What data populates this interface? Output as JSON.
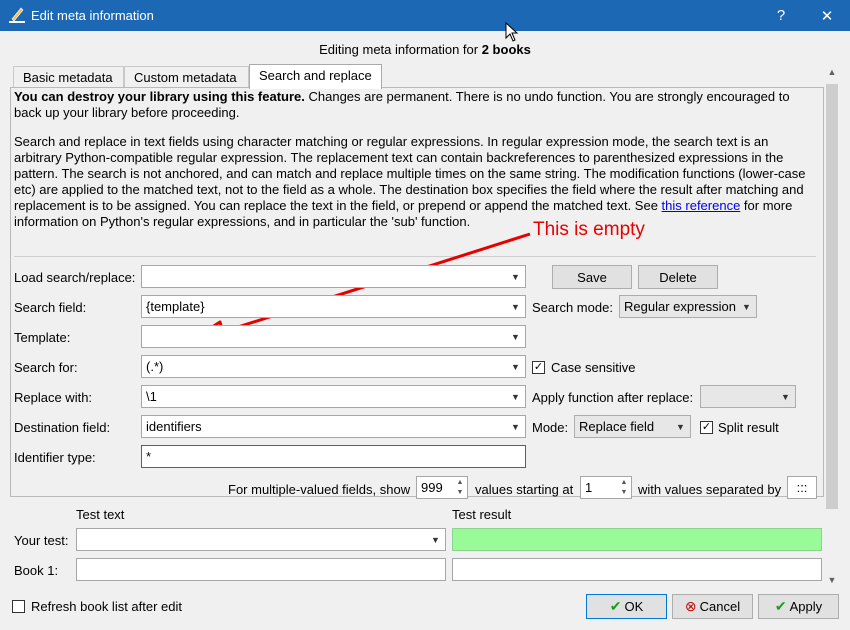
{
  "window": {
    "title": "Edit meta information",
    "help_glyph": "?",
    "close_glyph": "✕"
  },
  "heading": {
    "prefix": "Editing meta information for ",
    "count": "2 books"
  },
  "tabs": [
    {
      "label": "Basic metadata",
      "active": false
    },
    {
      "label": "Custom metadata",
      "active": false
    },
    {
      "label": "Search and replace",
      "active": true
    }
  ],
  "description": {
    "warning_bold": "You can destroy your library using this feature.",
    "warning_rest": " Changes are permanent. There is no undo function. You are strongly encouraged to back up your library before proceeding.",
    "para_before_link": "Search and replace in text fields using character matching or regular expressions. In regular expression mode, the search text is an arbitrary Python-compatible regular expression. The replacement text can contain backreferences to parenthesized expressions in the pattern. The search is not anchored, and can match and replace multiple times on the same string. The modification functions (lower-case etc) are applied to the matched text, not to the field as a whole. The destination box specifies the field where the result after matching and replacement is to be assigned. You can replace the text in the field, or prepend or append the matched text. See ",
    "link_text": "this reference",
    "para_after_link": " for more information on Python's regular expressions, and in particular the 'sub' function."
  },
  "annotation": "This is empty",
  "form": {
    "load_label": "Load search/replace:",
    "load_value": "",
    "save_label": "Save",
    "delete_label": "Delete",
    "search_field_label": "Search field:",
    "search_field_value": "{template}",
    "search_mode_label": "Search mode:",
    "search_mode_value": "Regular expression",
    "template_label": "Template:",
    "template_value": "",
    "search_for_label": "Search for:",
    "search_for_value": "(.*)",
    "case_sensitive_label": "Case sensitive",
    "case_sensitive_checked": true,
    "replace_with_label": "Replace with:",
    "replace_with_value": "\\1",
    "apply_function_label": "Apply function after replace:",
    "apply_function_value": "",
    "destination_label": "Destination field:",
    "destination_value": "identifiers",
    "mode_label": "Mode:",
    "mode_value": "Replace field",
    "split_result_label": "Split result",
    "split_result_checked": true,
    "identifier_type_label": "Identifier type:",
    "identifier_type_value": "*",
    "multi_prefix": "For multiple-valued fields, show",
    "multi_show_value": "999",
    "multi_mid": "values starting at",
    "multi_start_value": "1",
    "multi_suffix": "with values separated by",
    "multi_sep_value": ":::"
  },
  "test": {
    "test_text_header": "Test text",
    "test_result_header": "Test result",
    "your_test_label": "Your test:",
    "your_test_value": "",
    "book1_label": "Book 1:",
    "book1_text": "",
    "book1_result": ""
  },
  "footer": {
    "refresh_label": "Refresh book list after edit",
    "refresh_checked": false,
    "ok_label": "OK",
    "cancel_label": "Cancel",
    "apply_label": "Apply"
  },
  "colors": {
    "titlebar": "#1c68b5",
    "annotation": "#e80000",
    "test_result_bg": "#98fb98",
    "ok_check": "#1a9e1a",
    "cancel_x": "#c40000"
  }
}
